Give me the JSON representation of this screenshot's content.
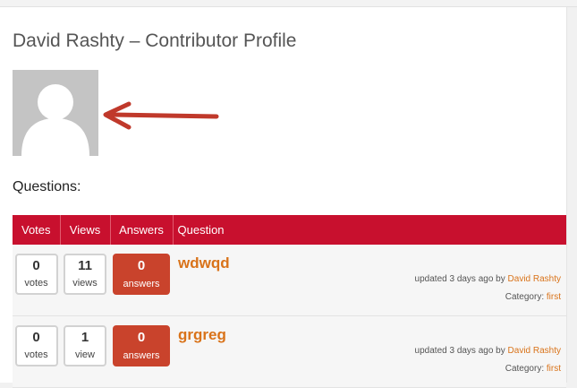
{
  "profile": {
    "title": "David Rashty – Contributor Profile",
    "avatar_icon": "default-user-silhouette-icon",
    "arrow_color": "#c0392b"
  },
  "questions_heading": "Questions:",
  "table": {
    "headers": {
      "votes": "Votes",
      "views": "Views",
      "answers": "Answers",
      "question": "Question"
    },
    "header_color": "#c8102e",
    "answers_box_color": "#c9432c",
    "rows": [
      {
        "votes": "0",
        "votes_label": "votes",
        "views": "11",
        "views_label": "views",
        "answers": "0",
        "answers_label": "answers",
        "question": "wdwqd",
        "updated_text": "updated 3 days ago by",
        "author": "David Rashty",
        "category_label": "Category:",
        "category": "first"
      },
      {
        "votes": "0",
        "votes_label": "votes",
        "views": "1",
        "views_label": "view",
        "answers": "0",
        "answers_label": "answers",
        "question": "grgreg",
        "updated_text": "updated 3 days ago by",
        "author": "David Rashty",
        "category_label": "Category:",
        "category": "first"
      }
    ]
  }
}
